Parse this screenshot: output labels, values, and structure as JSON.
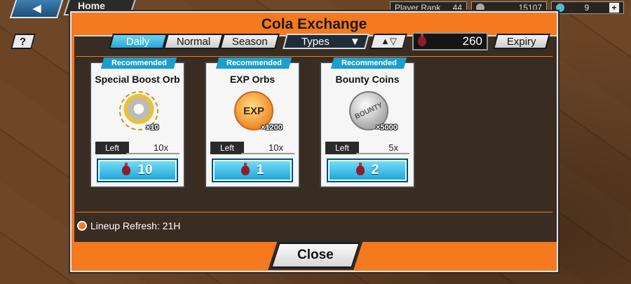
{
  "topbar": {
    "back_glyph": "◀",
    "home_label": "Home",
    "player_rank_label": "Player Rank",
    "player_rank": "44",
    "coins": "15107",
    "gems": "9",
    "plus_glyph": "+"
  },
  "dialog": {
    "title": "Cola Exchange"
  },
  "toolbar": {
    "help_label": "?",
    "tabs": [
      {
        "label": "Daily",
        "active": true
      },
      {
        "label": "Normal"
      },
      {
        "label": "Season"
      }
    ],
    "types_label": "Types",
    "types_arrow": "▼",
    "sort_glyph": "▲▽",
    "cola_count": "260",
    "expiry_label": "Expiry"
  },
  "cards": [
    {
      "badge": "Recommended",
      "name": "Special Boost Orb",
      "icon": "boost-orb-icon",
      "qty": "×10",
      "left_label": "Left",
      "left_value": "10x",
      "price": "10"
    },
    {
      "badge": "Recommended",
      "name": "EXP Orbs",
      "icon": "exp-orb-icon",
      "icon_text": "EXP",
      "qty": "×1200",
      "left_label": "Left",
      "left_value": "10x",
      "price": "1"
    },
    {
      "badge": "Recommended",
      "name": "Bounty Coins",
      "icon": "bounty-coin-icon",
      "icon_text": "BOUNTY",
      "qty": "×5000",
      "left_label": "Left",
      "left_value": "5x",
      "price": "2"
    }
  ],
  "footer": {
    "refresh_text": "Lineup Refresh: 21H",
    "close_label": "Close"
  },
  "colors": {
    "accent_orange": "#f4791f",
    "button_cyan": "#28a6d8"
  }
}
